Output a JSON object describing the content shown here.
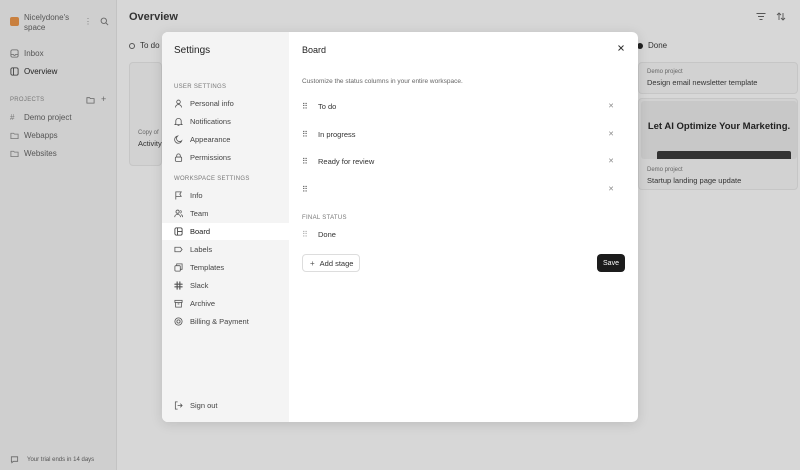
{
  "app": {
    "workspace_name": "Nicelydone's space",
    "sidebar": {
      "items": [
        {
          "label": "Inbox",
          "icon": "inbox-icon"
        },
        {
          "label": "Overview",
          "icon": "board-icon"
        }
      ],
      "projects_label": "PROJECTS",
      "projects": [
        {
          "label": "Demo project",
          "icon": "hash-icon"
        },
        {
          "label": "Webapps",
          "icon": "folder-icon"
        },
        {
          "label": "Websites",
          "icon": "folder-icon"
        }
      ],
      "trial_text": "Your trial ends in 14 days"
    },
    "main_title": "Overview",
    "columns": [
      {
        "label": "To do"
      },
      {
        "label": "Done"
      }
    ],
    "cards": [
      {
        "sub": "Copy of",
        "title": "Activity"
      },
      {
        "sub": "Demo project",
        "title": "Design email newsletter template"
      },
      {
        "sub": "Demo project",
        "title": "Startup landing page update"
      }
    ],
    "preview_heading": "Let AI Optimize Your Marketing."
  },
  "settings": {
    "title": "Settings",
    "user_section": "USER SETTINGS",
    "user_items": [
      {
        "label": "Personal info",
        "icon": "user-icon"
      },
      {
        "label": "Notifications",
        "icon": "bell-icon"
      },
      {
        "label": "Appearance",
        "icon": "moon-icon"
      },
      {
        "label": "Permissions",
        "icon": "lock-icon"
      }
    ],
    "workspace_section": "WORKSPACE SETTINGS",
    "workspace_items": [
      {
        "label": "Info",
        "icon": "flag-icon"
      },
      {
        "label": "Team",
        "icon": "team-icon"
      },
      {
        "label": "Board",
        "icon": "board-icon"
      },
      {
        "label": "Labels",
        "icon": "label-icon"
      },
      {
        "label": "Templates",
        "icon": "templates-icon"
      },
      {
        "label": "Slack",
        "icon": "slack-icon"
      },
      {
        "label": "Archive",
        "icon": "archive-icon"
      },
      {
        "label": "Billing & Payment",
        "icon": "billing-icon"
      }
    ],
    "sign_out": "Sign out",
    "panel": {
      "title": "Board",
      "description": "Customize the status columns in your entire workspace.",
      "stages": [
        {
          "name": "To do"
        },
        {
          "name": "In progress"
        },
        {
          "name": "Ready for review"
        },
        {
          "name": ""
        }
      ],
      "final_status_label": "FINAL STATUS",
      "final_stage": "Done",
      "add_stage_label": "Add stage",
      "save_label": "Save"
    }
  }
}
